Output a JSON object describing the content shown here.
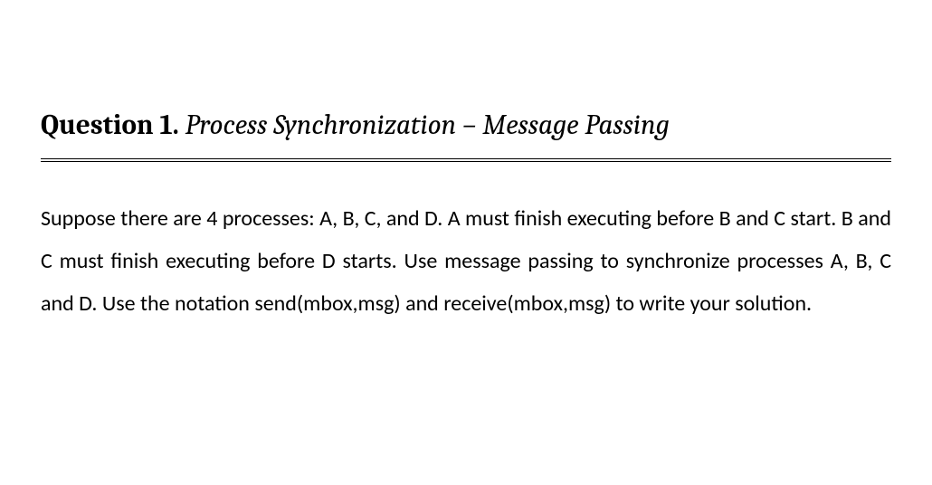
{
  "heading": {
    "label": "Question 1.",
    "title": "Process Synchronization – Message Passing"
  },
  "body": "Suppose there are 4 processes: A, B, C, and D. A must finish executing before B and C start. B and C must finish executing before D starts. Use message passing to synchronize processes A, B, C and D. Use the notation send(mbox,msg) and receive(mbox,msg) to write your solution."
}
